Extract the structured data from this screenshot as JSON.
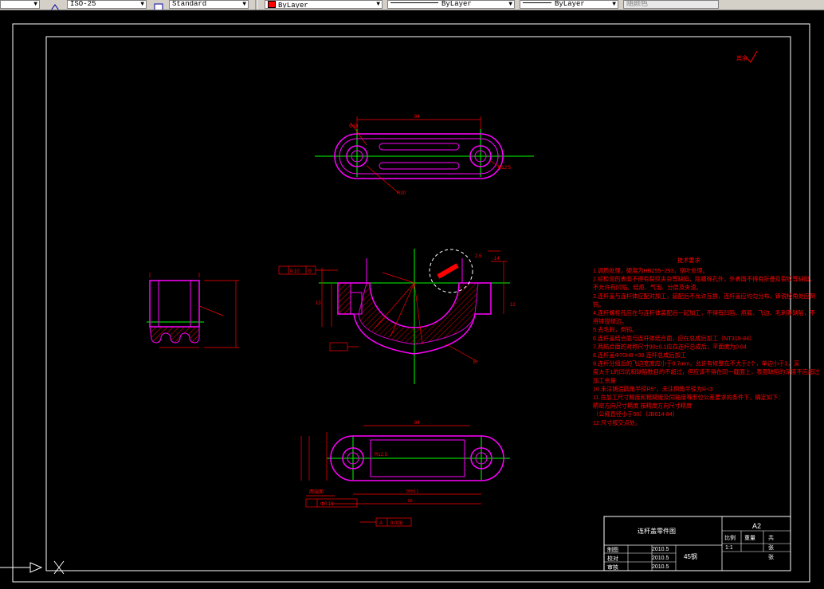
{
  "toolbar": {
    "dimstyle": "ISO-25",
    "textstyle": "Standard",
    "color": "ByLayer",
    "linetype": "ByLayer",
    "lineweight": "ByLayer",
    "plotstyle": "随颜色",
    "colors": {
      "toolbar_bg": "#d4d0c8",
      "swatch": "#ff0000"
    }
  },
  "drawing": {
    "colors": {
      "background": "#000000",
      "frame": "#ffffff",
      "part": "#ff00ff",
      "dimension": "#ff0000",
      "centerline": "#00ff00",
      "hatch": "#ff0000"
    },
    "roughness_symbol": "其余",
    "technical_requirements": {
      "title": "技术要求",
      "lines": [
        "1.调质处理，硬度为HB255~293，铆叶处理。",
        "2.经检测的表面不得有裂纹夹杂等缺陷，除螺栓孔外，外表面不得有折叠及裂纹等缺陷，不允许有凹陷、结疤、气泡、分层及夹渣。",
        "3.连杆盖与连杆体应配对加工，装配后不允许互换，连杆盖应均匀分布，锋锐棱角处应倒钝。",
        "4.连杆螺栓孔应在与连杆体装配后一起加工，不得有凹陷、疤痕、飞边、毛刺等缺陷，不得锋锐棱边。",
        "5.去毛刺，倒钝。",
        "6.连杆盖结合面与连杆体结合面，应在总成后加工（NT319-84）",
        "7.两结合面的对称尺寸90±0.1应在连杆总成后，平面度为0.04",
        "8.连杆盖Φ70H8 =38 连杆总成后加工",
        "9.连杆分组后的飞边宽度应小于0.7mm，允许有修整在不大于2个，单边小于3，深度大于1的凹坑和缺陷数目的不超过，但应该不得在同一截面上，表面缺陷的深度不应超过加工余量",
        "10.未注铸造圆角半径R5°，未注倒角半径为R<3",
        "11.在加工尺寸精度和粗糙度及同轴度等形位公差要求的条件下，确定如下：",
        "  精密方向尺寸精度   按精度方向尺寸精度",
        "  （公称直径小于50）（JB614-84）",
        "12.尺寸按交点处。"
      ]
    },
    "title_block": {
      "name": "连杆盖零件图",
      "sheet": "A2",
      "headers": [
        "比例",
        "重量",
        "共"
      ],
      "scale": "1:1",
      "sheet_label_1": "张",
      "sheet_label_2": "张",
      "rows": [
        {
          "role": "制图",
          "date": "2010.5"
        },
        {
          "role": "校对",
          "date": "2010.5"
        },
        {
          "role": "审核",
          "date": "2010.5"
        }
      ],
      "material": "45钢"
    },
    "top_view": {
      "width_dim": "84",
      "hole_note": "Φ18",
      "r_note": "R12.5",
      "tilt": "R20"
    },
    "front_view": {
      "tol1": "0.10",
      "tol_ref": "B",
      "dims": [
        "2.5",
        "14",
        "R25",
        "R35",
        "R70",
        "R30",
        "12",
        "B"
      ],
      "left_dim": "13"
    },
    "bottom_view": {
      "width_dim": "84",
      "mid_dim": "R12.5",
      "lower_dim": "90±0.1",
      "overall_dim": "60",
      "note": "两端面",
      "tol_box": "Φ0.10",
      "tol_box2": "0.008",
      "tol_box2_ref": "A"
    }
  }
}
